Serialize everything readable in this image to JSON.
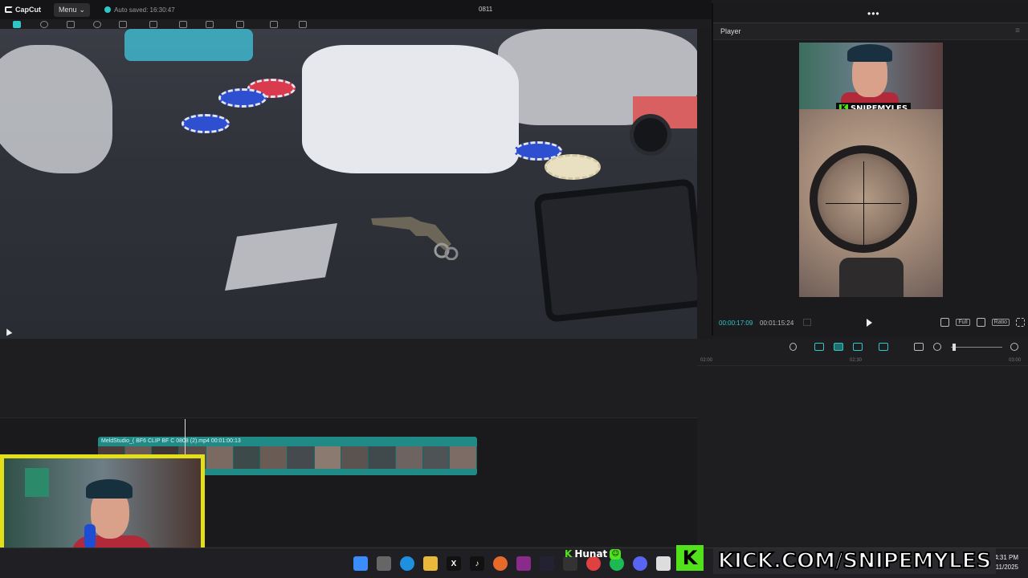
{
  "app": {
    "logo_text": "CapCut",
    "menu_label": "Menu",
    "autosave_text": "Auto saved: 16:30:47",
    "project_title": "0811"
  },
  "player": {
    "title": "Player",
    "overlay_name": "SNIPEMYLES",
    "current_time": "00:00:17:09",
    "duration": "00:01:15:24",
    "controls": [
      "Full",
      "Ratio"
    ]
  },
  "timeline": {
    "ruler_labels": [
      "02:00",
      "02:30",
      "03:00"
    ],
    "clip_label": "MeldStudio_(  BF6 CLIP  BF C  0808 (2).mp4  00:01:00:13"
  },
  "stream_overlay": {
    "kick_badge": "Hunat",
    "kick_url": "KICK.COM/SNIPEMYLES"
  },
  "taskbar": {
    "time": "4:31 PM",
    "date": "8/11/2025"
  },
  "colors": {
    "accent": "#2fc7c7",
    "kick_green": "#52e21b",
    "webcam_border": "#e3e01a"
  }
}
